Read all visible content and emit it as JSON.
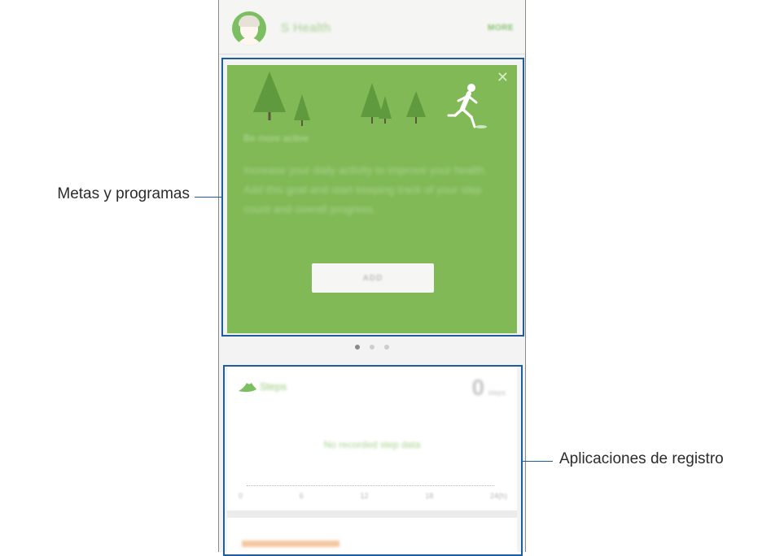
{
  "app": {
    "title": "S Health",
    "more_label": "MORE",
    "avatar_icon": "user-avatar-icon"
  },
  "goal_card": {
    "title": "Be more active",
    "description": "Increase your daily activity to improve your health. Add this goal and start keeping track of your step count and overall progress.",
    "add_label": "ADD",
    "close_icon": "close-icon",
    "background_color": "#80b955"
  },
  "pager": {
    "count": 3,
    "active": 0
  },
  "tracker_card": {
    "title": "Steps",
    "step_count": "0",
    "step_unit": "steps",
    "empty_message": "No recorded step data",
    "timeline_labels": [
      "0",
      "6",
      "12",
      "18",
      "24(h)"
    ]
  },
  "callouts": {
    "goals": "Metas y programas",
    "trackers": "Aplicaciones de registro"
  },
  "colors": {
    "highlight": "#1f5d9b",
    "accent_green": "#80b955"
  }
}
